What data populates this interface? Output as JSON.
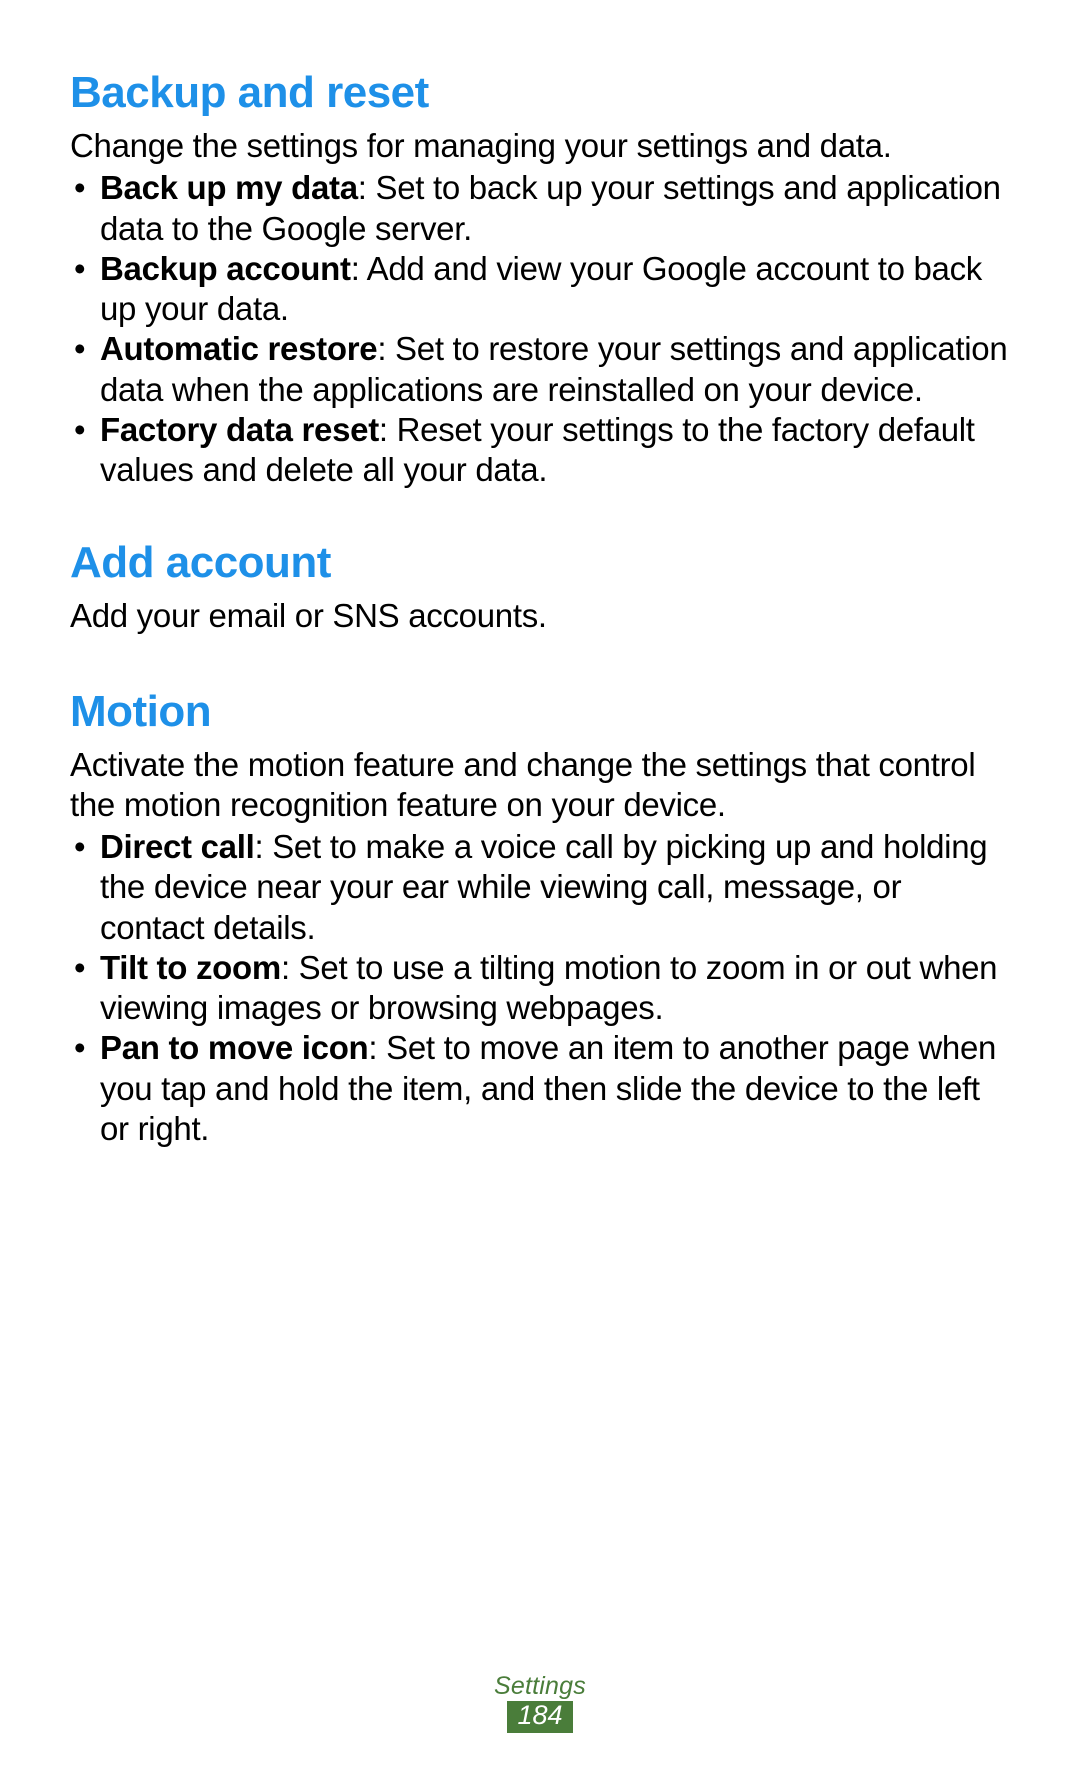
{
  "sections": [
    {
      "heading": "Backup and reset",
      "intro": "Change the settings for managing your settings and data.",
      "bullets": [
        {
          "bold": "Back up my data",
          "rest": ": Set to back up your settings and application data to the Google server."
        },
        {
          "bold": "Backup account",
          "rest": ": Add and view your Google account to back up your data."
        },
        {
          "bold": "Automatic restore",
          "rest": ": Set to restore your settings and application data when the applications are reinstalled on your device."
        },
        {
          "bold": "Factory data reset",
          "rest": ": Reset your settings to the factory default values and delete all your data."
        }
      ]
    },
    {
      "heading": "Add account",
      "intro": "Add your email or SNS accounts.",
      "bullets": []
    },
    {
      "heading": "Motion",
      "intro": "Activate the motion feature and change the settings that control the motion recognition feature on your device.",
      "bullets": [
        {
          "bold": "Direct call",
          "rest": ": Set to make a voice call by picking up and holding the device near your ear while viewing call, message, or contact details."
        },
        {
          "bold": "Tilt to zoom",
          "rest": ": Set to use a tilting motion to zoom in or out when viewing images or browsing webpages."
        },
        {
          "bold": "Pan to move icon",
          "rest": ": Set to move an item to another page when you tap and hold the item, and then slide the device to the left or right."
        }
      ]
    }
  ],
  "footer": {
    "label": "Settings",
    "page_number": "184"
  }
}
